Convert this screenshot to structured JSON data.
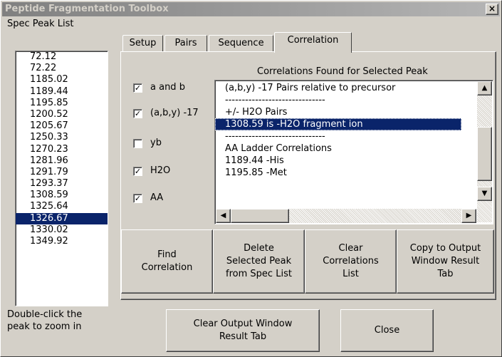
{
  "window": {
    "title": "Peptide Fragmentation Toolbox",
    "close_glyph": "×"
  },
  "spec_panel": {
    "label": "Spec Peak List",
    "peaks": [
      "72.12",
      "72.22",
      "1185.02",
      "1189.44",
      "1195.85",
      "1200.52",
      "1205.67",
      "1250.33",
      "1270.23",
      "1281.96",
      "1291.79",
      "1293.37",
      "1308.59",
      "1325.64",
      "1326.67",
      "1330.02",
      "1349.92"
    ],
    "selected_peak": "1326.67",
    "hint": "Double-click the\npeak to zoom in"
  },
  "tabs": [
    {
      "label": "Setup",
      "active": false
    },
    {
      "label": "Pairs",
      "active": false
    },
    {
      "label": "Sequence",
      "active": false
    },
    {
      "label": "Correlation",
      "active": true
    }
  ],
  "correlation": {
    "list_title": "Correlations Found for Selected Peak",
    "checkboxes": [
      {
        "label": "a and b",
        "checked": true
      },
      {
        "label": "(a,b,y) -17",
        "checked": true
      },
      {
        "label": "yb",
        "checked": false
      },
      {
        "label": "H2O",
        "checked": true
      },
      {
        "label": "AA",
        "checked": true
      }
    ],
    "items": [
      "(a,b,y) -17 Pairs relative to precursor",
      "------------------------------",
      "+/- H2O Pairs",
      "1308.59 is -H2O fragment ion",
      "------------------------------",
      "AA Ladder Correlations",
      "1189.44 -His",
      "1195.85 -Met"
    ],
    "selected_item": "1308.59 is -H2O fragment ion",
    "buttons": {
      "find": "Find\nCorrelation",
      "delete": "Delete\nSelected Peak\nfrom Spec List",
      "clear": "Clear\nCorrelations\nList",
      "copy": "Copy to Output\nWindow Result\nTab"
    }
  },
  "footer": {
    "clear_output": "Clear Output Window\nResult Tab",
    "close": "Close"
  },
  "icons": {
    "check_glyph": "✓",
    "scroll_up": "▲",
    "scroll_down": "▼",
    "scroll_left": "◀",
    "scroll_right": "▶"
  },
  "colors": {
    "selection": "#0a246a",
    "face": "#d4d0c8"
  }
}
